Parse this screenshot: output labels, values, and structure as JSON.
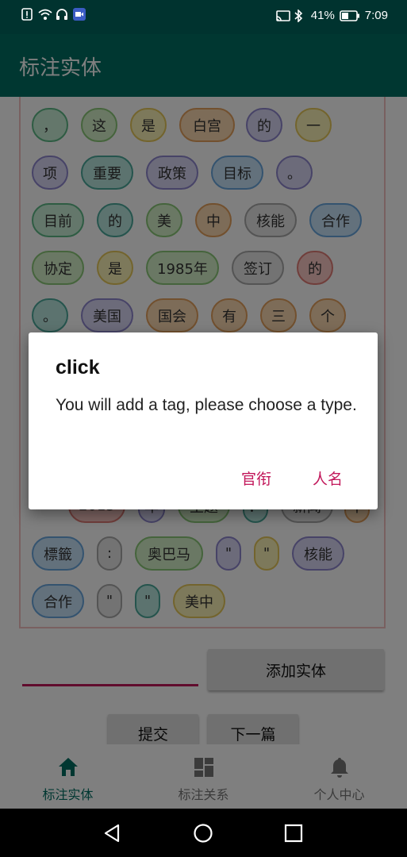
{
  "status_bar": {
    "battery": "41%",
    "time": "7:09",
    "icons": [
      "alert-icon",
      "wifi-icon",
      "headset-icon",
      "video-icon",
      "cast-icon",
      "bluetooth-icon",
      "battery-icon"
    ]
  },
  "app_bar": {
    "title": "标注实体"
  },
  "tags": [
    {
      "text": "，",
      "color": "green"
    },
    {
      "text": "这",
      "color": "mint"
    },
    {
      "text": "是",
      "color": "yellow"
    },
    {
      "text": "白宫",
      "color": "orange"
    },
    {
      "text": "的",
      "color": "lav"
    },
    {
      "text": "一",
      "color": "yellow"
    },
    {
      "text": "项",
      "color": "lav"
    },
    {
      "text": "重要",
      "color": "teal"
    },
    {
      "text": "政策",
      "color": "lav"
    },
    {
      "text": "目标",
      "color": "blue"
    },
    {
      "text": "。",
      "color": "lav"
    },
    {
      "text": "目前",
      "color": "green"
    },
    {
      "text": "的",
      "color": "teal"
    },
    {
      "text": "美",
      "color": "mint"
    },
    {
      "text": "中",
      "color": "orange"
    },
    {
      "text": "核能",
      "color": "grey"
    },
    {
      "text": "合作",
      "color": "blue"
    },
    {
      "text": "协定",
      "color": "mint"
    },
    {
      "text": "是",
      "color": "yellow"
    },
    {
      "text": "1985年",
      "color": "mint"
    },
    {
      "text": "签订",
      "color": "grey"
    },
    {
      "text": "的",
      "color": "pink"
    },
    {
      "text": "。",
      "color": "teal"
    },
    {
      "text": "美国",
      "color": "lav"
    },
    {
      "text": "国会",
      "color": "orange"
    },
    {
      "text": "有",
      "color": "orange"
    },
    {
      "text": "三",
      "color": "orange"
    },
    {
      "text": "个",
      "color": "orange"
    },
    {
      "text": "2015",
      "color": "pink"
    },
    {
      "text": "年",
      "color": "lav"
    },
    {
      "text": "主题",
      "color": "mint"
    },
    {
      "text": "：",
      "color": "teal"
    },
    {
      "text": "新闻",
      "color": "grey"
    },
    {
      "text": "中",
      "color": "orange"
    },
    {
      "text": "標籤",
      "color": "blue"
    },
    {
      "text": ":",
      "color": "grey"
    },
    {
      "text": "奥巴马",
      "color": "mint"
    },
    {
      "text": "\"",
      "color": "lav"
    },
    {
      "text": "\"",
      "color": "yellow"
    },
    {
      "text": "核能",
      "color": "lav"
    },
    {
      "text": "合作",
      "color": "blue"
    },
    {
      "text": "\"",
      "color": "grey"
    },
    {
      "text": "\"",
      "color": "teal"
    },
    {
      "text": "美中",
      "color": "yellow"
    }
  ],
  "add_entity_button": "添加实体",
  "submit_button": "提交",
  "next_button": "下一篇",
  "bottom_nav": [
    {
      "label": "标注实体",
      "icon": "home-icon",
      "active": true
    },
    {
      "label": "标注关系",
      "icon": "dashboard-icon",
      "active": false
    },
    {
      "label": "个人中心",
      "icon": "bell-icon",
      "active": false
    }
  ],
  "dialog": {
    "title": "click",
    "message": "You will add a tag, please choose a type.",
    "option_1": "官衔",
    "option_2": "人名"
  },
  "colors": {
    "primary": "#006f63",
    "status_bar": "#00332f",
    "accent": "#c2185b"
  }
}
